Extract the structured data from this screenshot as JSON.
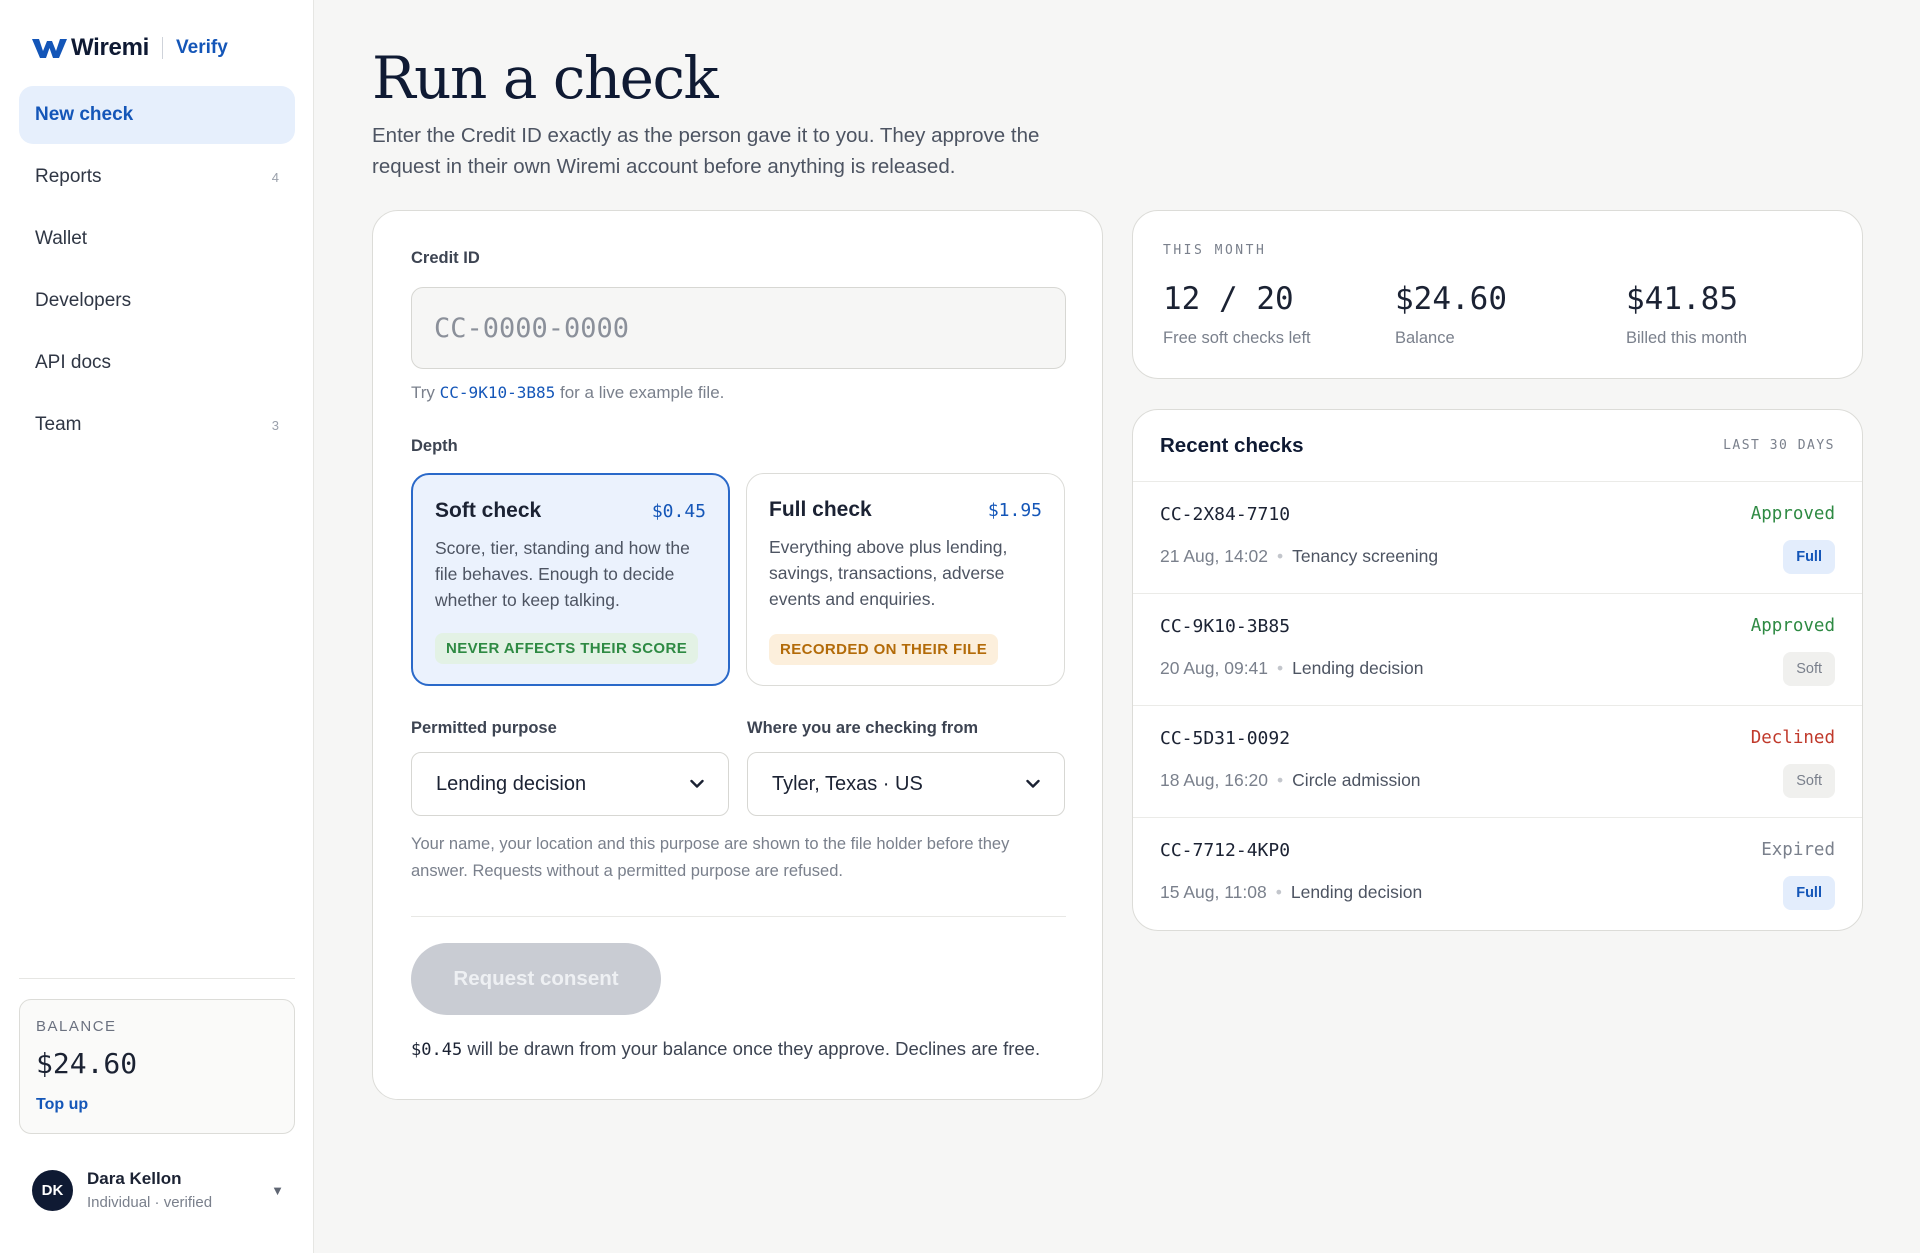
{
  "brand": {
    "name": "Wiremi",
    "product": "Verify"
  },
  "nav": [
    {
      "label": "New check",
      "count": "",
      "active": true
    },
    {
      "label": "Reports",
      "count": "4"
    },
    {
      "label": "Wallet",
      "count": ""
    },
    {
      "label": "Developers",
      "count": ""
    },
    {
      "label": "API docs",
      "count": ""
    },
    {
      "label": "Team",
      "count": "3"
    }
  ],
  "sidebar_balance": {
    "label": "BALANCE",
    "value": "$24.60",
    "action": "Top up"
  },
  "user": {
    "initials": "DK",
    "name": "Dara Kellon",
    "subtitle": "Individual · verified"
  },
  "page": {
    "title": "Run a check",
    "description": "Enter the Credit ID exactly as the person gave it to you. They approve the request in their own Wiremi account before anything is released."
  },
  "form": {
    "credit_label": "Credit ID",
    "credit_placeholder": "CC-0000-0000",
    "hint_prefix": "Try",
    "hint_code": "CC-9K10-3B85",
    "hint_suffix": "for a live example file.",
    "depth_label": "Depth",
    "depth_options": [
      {
        "title": "Soft check",
        "price": "$0.45",
        "description": "Score, tier, standing and how the file behaves. Enough to decide whether to keep talking.",
        "tag": "NEVER AFFECTS THEIR SCORE",
        "selected": true
      },
      {
        "title": "Full check",
        "price": "$1.95",
        "description": "Everything above plus lending, savings, transactions, adverse events and enquiries.",
        "tag": "RECORDED ON THEIR FILE",
        "selected": false
      }
    ],
    "purpose_label": "Permitted purpose",
    "purpose_value": "Lending decision",
    "location_label": "Where you are checking from",
    "location_value": "Tyler, Texas · US",
    "fine_print": "Your name, your location and this purpose are shown to the file holder before they answer. Requests without a permitted purpose are refused.",
    "submit_label": "Request consent",
    "draw_amount": "$0.45",
    "draw_note": "will be drawn from your balance once they approve. Declines are free."
  },
  "stats": {
    "label": "THIS MONTH",
    "items": [
      {
        "value": "12 / 20",
        "caption": "Free soft checks left"
      },
      {
        "value": "$24.60",
        "caption": "Balance"
      },
      {
        "value": "$41.85",
        "caption": "Billed this month"
      }
    ]
  },
  "recent": {
    "title": "Recent checks",
    "range": "LAST 30 DAYS",
    "rows": [
      {
        "code": "CC-2X84-7710",
        "time": "21 Aug, 14:02",
        "purpose": "Tenancy screening",
        "status": "Approved",
        "type": "Full"
      },
      {
        "code": "CC-9K10-3B85",
        "time": "20 Aug, 09:41",
        "purpose": "Lending decision",
        "status": "Approved",
        "type": "Soft"
      },
      {
        "code": "CC-5D31-0092",
        "time": "18 Aug, 16:20",
        "purpose": "Circle admission",
        "status": "Declined",
        "type": "Soft"
      },
      {
        "code": "CC-7712-4KP0",
        "time": "15 Aug, 11:08",
        "purpose": "Lending decision",
        "status": "Expired",
        "type": "Full"
      }
    ]
  },
  "colors": {
    "accent": "#1456b8",
    "approved": "#2e8a43",
    "declined": "#c0392b",
    "brand_dark": "#0f1a33"
  },
  "icons": {
    "logo": "wiremi-w-logo",
    "select": "chevron-down-icon",
    "user_menu": "caret-down-icon"
  }
}
